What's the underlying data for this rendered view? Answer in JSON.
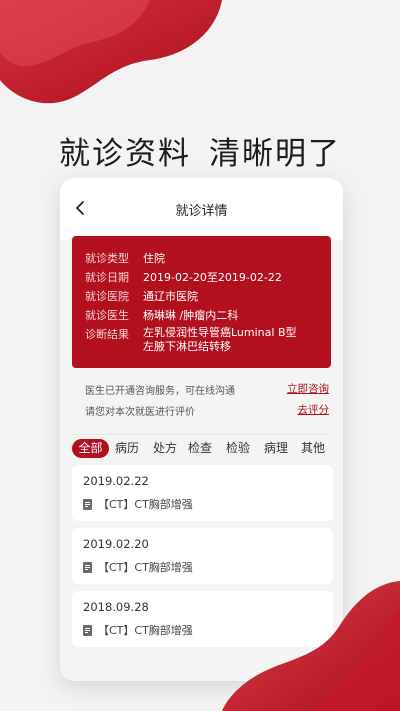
{
  "headline": {
    "part1": "就诊资料",
    "part2": "清晰明了"
  },
  "nav": {
    "title": "就诊详情",
    "back_icon": "chevron-left-icon"
  },
  "visit": {
    "rows": [
      {
        "label": "就诊类型",
        "value": "住院"
      },
      {
        "label": "就诊日期",
        "value": "2019-02-20至2019-02-22"
      },
      {
        "label": "就诊医院",
        "value": "通辽市医院"
      },
      {
        "label": "就诊医生",
        "value": "杨琳琳 /肿瘤内二科"
      }
    ],
    "diagnosis": {
      "label": "诊断结果",
      "line1": "左乳侵润性导管癌Luminal B型",
      "line2": "左腋下淋巴结转移"
    }
  },
  "notice": {
    "consult_text": "医生已开通咨询服务，可在线沟通",
    "consult_action": "立即咨询",
    "rate_text": "请您对本次就医进行评价",
    "rate_action": "去评分"
  },
  "tabs": [
    "全部",
    "病历",
    "处方",
    "检查",
    "检验",
    "病理",
    "其他"
  ],
  "active_tab": "全部",
  "records": [
    {
      "date": "2019.02.22",
      "desc": "【CT】CT胸部增强",
      "icon": "document-icon"
    },
    {
      "date": "2019.02.20",
      "desc": "【CT】CT胸部增强",
      "icon": "document-icon"
    },
    {
      "date": "2018.09.28",
      "desc": "【CT】CT胸部增强",
      "icon": "document-icon"
    }
  ],
  "colors": {
    "accent": "#b3101f",
    "background": "#f3f3f4",
    "card": "#ffffff"
  }
}
